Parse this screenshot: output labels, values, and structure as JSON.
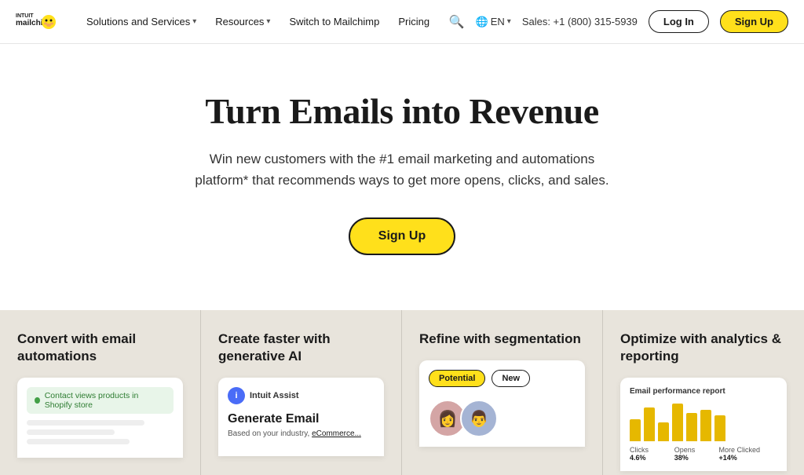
{
  "nav": {
    "logo_alt": "Intuit Mailchimp",
    "links": [
      {
        "label": "Solutions and Services",
        "hasDropdown": true
      },
      {
        "label": "Resources",
        "hasDropdown": true
      },
      {
        "label": "Switch to Mailchimp",
        "hasDropdown": false
      },
      {
        "label": "Pricing",
        "hasDropdown": false
      }
    ],
    "search_label": "Search",
    "lang_label": "EN",
    "phone": "Sales: +1 (800) 315-5939",
    "login_label": "Log In",
    "signup_label": "Sign Up"
  },
  "hero": {
    "title": "Turn Emails into Revenue",
    "subtitle": "Win new customers with the #1 email marketing and automations platform* that recommends ways to get more opens, clicks, and sales.",
    "cta_label": "Sign Up"
  },
  "features": [
    {
      "id": "card-automations",
      "title": "Convert with email automations",
      "pill_text": "Contact views products in Shopify store",
      "line2_width": "80%",
      "line3_width": "60%"
    },
    {
      "id": "card-ai",
      "title": "Create faster with generative AI",
      "badge": "Intuit Assist",
      "generate_title": "Generate Email",
      "generate_sub": "Based on your industry, eCommerce..."
    },
    {
      "id": "card-segmentation",
      "title": "Refine with segmentation",
      "chip1": "Potential",
      "chip2": "New"
    },
    {
      "id": "card-analytics",
      "title": "Optimize with analytics & reporting",
      "report_label": "Email performance report",
      "bars": [
        30,
        45,
        25,
        50,
        38,
        42,
        35
      ],
      "metrics": [
        {
          "label": "Clicks",
          "value": "4.6%"
        },
        {
          "label": "Opens",
          "value": "38%"
        },
        {
          "label": "More Clicked",
          "value": "+14%"
        }
      ]
    }
  ]
}
